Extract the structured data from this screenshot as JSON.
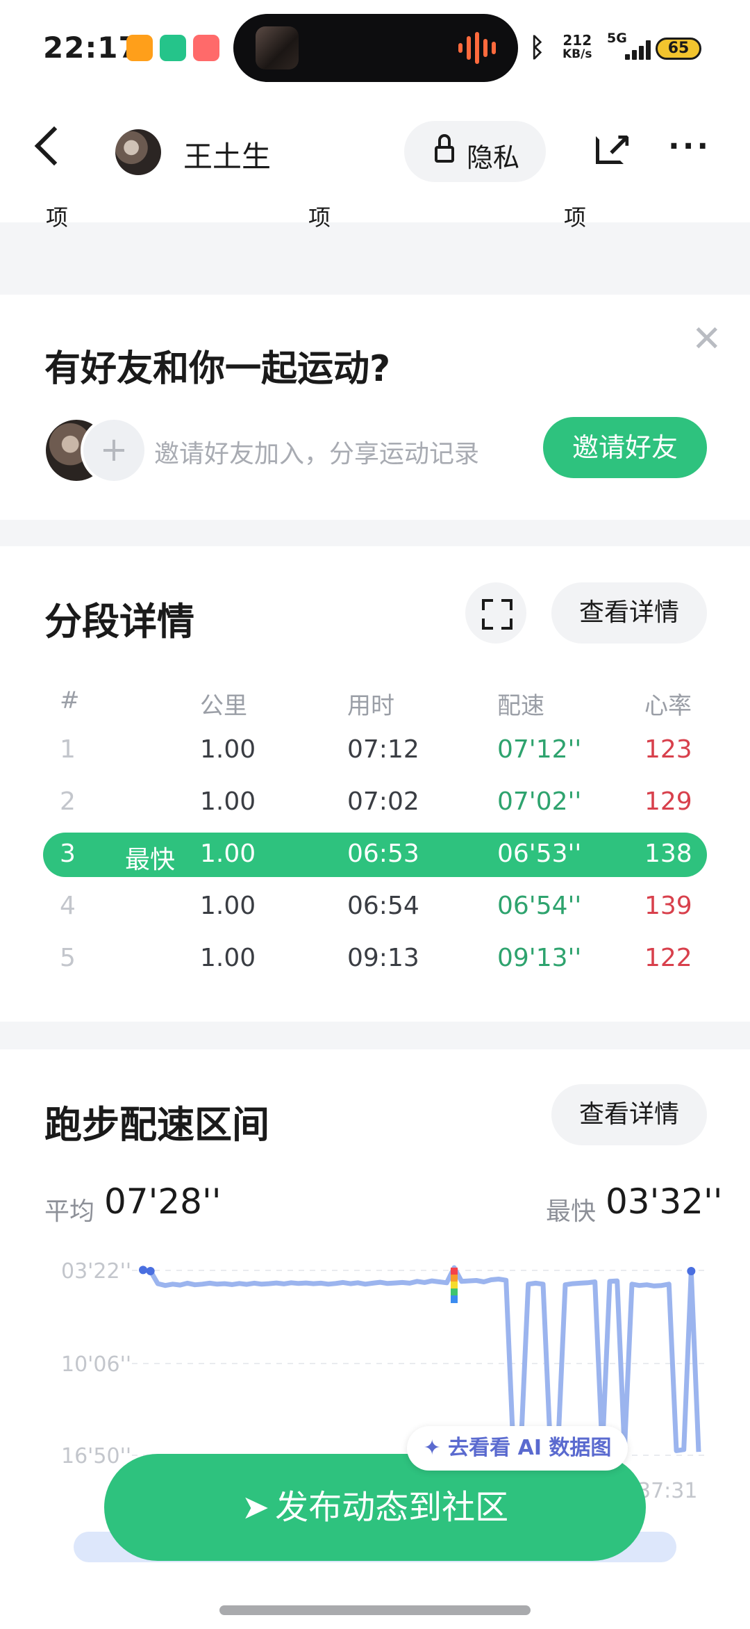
{
  "status_bar": {
    "time": "22:17",
    "net_speed_value": "212",
    "net_speed_unit": "KB/s",
    "network": "5G",
    "battery": "65"
  },
  "header": {
    "username": "王土生",
    "privacy_label": "隐私"
  },
  "stats_tail": [
    "项",
    "项",
    "项"
  ],
  "friend_card": {
    "title": "有好友和你一起运动?",
    "hint": "邀请好友加入，分享运动记录",
    "invite_label": "邀请好友"
  },
  "split_card": {
    "title": "分段详情",
    "details_label": "查看详情",
    "columns": [
      "#",
      "公里",
      "用时",
      "配速",
      "心率"
    ],
    "fastest_tag": "最快",
    "rows": [
      {
        "n": "1",
        "km": "1.00",
        "time": "07:12",
        "pace": "07'12''",
        "hr": "123"
      },
      {
        "n": "2",
        "km": "1.00",
        "time": "07:02",
        "pace": "07'02''",
        "hr": "129"
      },
      {
        "n": "3",
        "km": "1.00",
        "time": "06:53",
        "pace": "06'53''",
        "hr": "138"
      },
      {
        "n": "4",
        "km": "1.00",
        "time": "06:54",
        "pace": "06'54''",
        "hr": "139"
      },
      {
        "n": "5",
        "km": "1.00",
        "time": "09:13",
        "pace": "09'13''",
        "hr": "122"
      }
    ],
    "fastest_row_index": 2
  },
  "pace_card": {
    "title": "跑步配速区间",
    "details_label": "查看详情",
    "avg_label": "平均",
    "avg_value": "07'28''",
    "fast_label": "最快",
    "fast_value": "03'32''",
    "x_end_label": "37:31"
  },
  "chart_data": {
    "type": "line",
    "yticks": [
      "03'22''",
      "10'06''",
      "16'50''"
    ],
    "ylim_seconds": [
      202,
      1010
    ],
    "y_inverted": true,
    "x_end_label": "37:31",
    "series": [
      {
        "values": [
          200,
          205,
          260,
          268,
          262,
          266,
          258,
          265,
          262,
          258,
          262,
          260,
          264,
          259,
          263,
          258,
          262,
          260,
          257,
          261,
          256,
          259,
          257,
          260,
          258,
          262,
          259,
          255,
          260,
          256,
          262,
          258,
          254,
          259,
          257,
          255,
          258,
          250,
          255,
          248,
          252,
          256,
          190,
          250,
          248,
          246,
          252,
          243,
          240,
          245,
          990,
          980,
          262,
          258,
          262,
          990,
          985,
          265,
          260,
          258,
          256,
          252,
          990,
          250,
          248,
          985,
          262,
          268,
          265,
          270,
          268,
          262,
          990,
          985,
          205,
          995
        ]
      }
    ],
    "colors": {
      "line": "#9bb4ee",
      "dots": "#4a6fe0",
      "peak": "rainbow"
    }
  },
  "bottom": {
    "ai_chip": "去看看 AI 数据图",
    "publish_label": "发布动态到社区"
  },
  "colors": {
    "accent": "#2ec27e",
    "pace_text": "#2ea36e",
    "hr_text": "#d8404c"
  }
}
